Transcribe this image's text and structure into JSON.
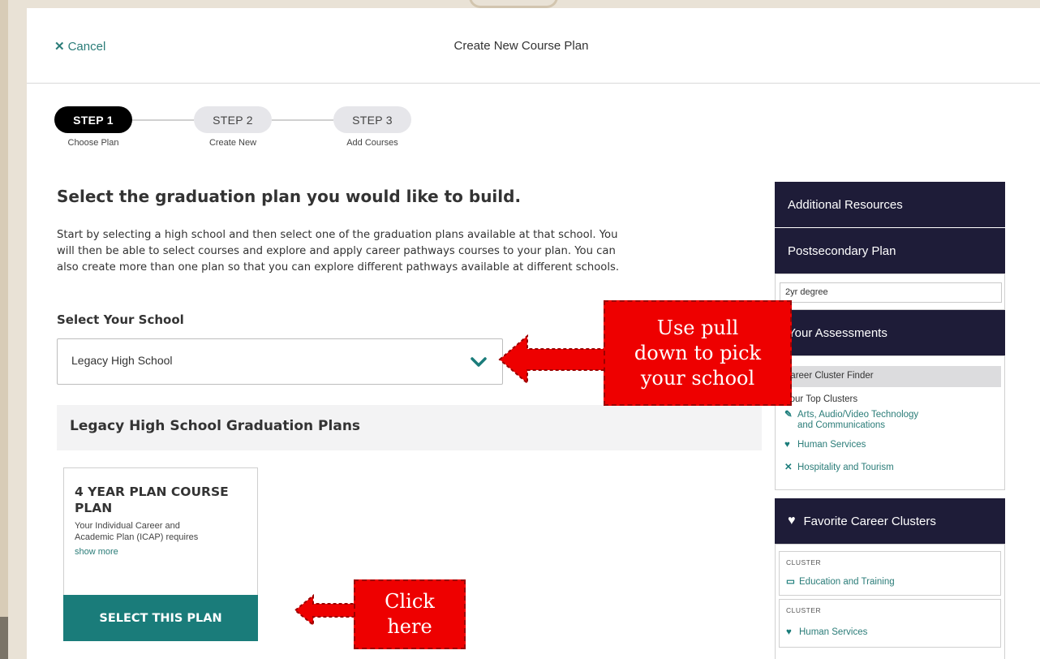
{
  "header": {
    "cancel_label": "Cancel",
    "title": "Create New Course Plan"
  },
  "stepper": [
    {
      "label": "STEP 1",
      "sub": "Choose Plan"
    },
    {
      "label": "STEP 2",
      "sub": "Create New"
    },
    {
      "label": "STEP 3",
      "sub": "Add Courses"
    }
  ],
  "main": {
    "heading": "Select the graduation plan you would like to build.",
    "intro_lines": [
      "Start by selecting a high school and then select one of the graduation plans available at that school. You",
      "will then be able to select courses and explore and apply career pathways courses to your plan. You can",
      "also create more than one plan so that you can explore different pathways available at different schools."
    ],
    "school_label": "Select Your School",
    "school_value": "Legacy High School",
    "plans_header": "Legacy High School Graduation Plans",
    "plan_card": {
      "title_lines": [
        "4 YEAR PLAN COURSE",
        "PLAN"
      ],
      "desc_lines": [
        "Your Individual Career and",
        "Academic Plan (ICAP) requires"
      ],
      "show_more": "show more",
      "button": "SELECT THIS PLAN"
    }
  },
  "sidebar": {
    "additional_resources": "Additional Resources",
    "postsecondary_plan": "Postsecondary Plan",
    "postsecondary_value": "2yr degree",
    "your_assessments": "Your Assessments",
    "finder_title": "Career Cluster Finder",
    "top_clusters_label": "Your Top Clusters",
    "top_clusters": [
      {
        "icon": "arts-icon",
        "lines": [
          "Arts, Audio/Video Technology",
          "and Communications"
        ]
      },
      {
        "icon": "human-services-icon",
        "lines": [
          "Human Services"
        ]
      },
      {
        "icon": "hospitality-icon",
        "lines": [
          "Hospitality and Tourism"
        ]
      }
    ],
    "favorite_clusters": "Favorite Career Clusters",
    "favorites": [
      {
        "tag": "CLUSTER",
        "name": "Education and Training",
        "icon": "education-icon"
      },
      {
        "tag": "CLUSTER",
        "name": "Human Services",
        "icon": "human-services-icon"
      }
    ]
  },
  "callouts": {
    "school_lines": [
      "Use pull",
      "down to pick",
      "your school"
    ],
    "click_lines": [
      "Click",
      "here"
    ]
  },
  "colors": {
    "accent": "#1a7c7a",
    "sidebar_header": "#1e1c38",
    "callout": "#ee0000"
  }
}
